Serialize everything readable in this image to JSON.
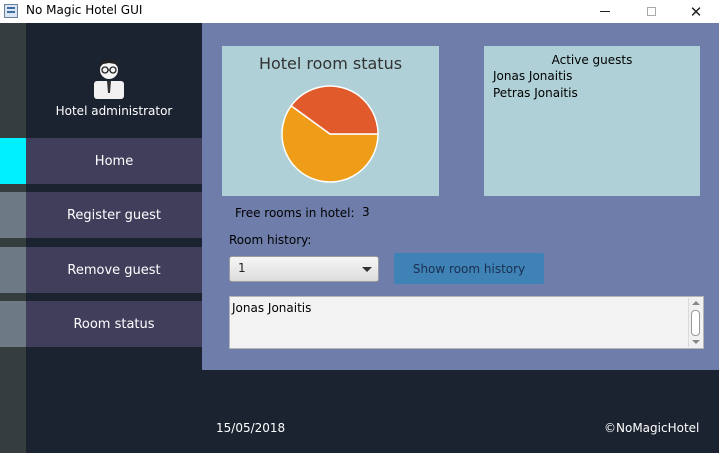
{
  "window": {
    "title": "No Magic Hotel GUI",
    "minimize_icon": "minimize-icon",
    "maximize_icon": "maximize-icon",
    "close_icon": "close-icon",
    "close_glyph": "✕"
  },
  "sidebar": {
    "avatar_icon": "hotel-administrator-avatar-icon",
    "user_label": "Hotel administrator",
    "items": [
      {
        "label": "Home",
        "active": true
      },
      {
        "label": "Register guest",
        "active": false
      },
      {
        "label": "Remove guest",
        "active": false
      },
      {
        "label": "Room status",
        "active": false
      }
    ],
    "active_color": "#00f0ff"
  },
  "room_status": {
    "title": "Hotel room status",
    "chart_data": {
      "type": "pie",
      "title": "Hotel room status",
      "slices": [
        {
          "value": 0.6,
          "color": "#ef9c18"
        },
        {
          "value": 0.4,
          "color": "#e05a2b"
        }
      ]
    }
  },
  "active_guests": {
    "title": "Active guests",
    "items": [
      "Jonas Jonaitis",
      "Petras Jonaitis"
    ]
  },
  "free_rooms": {
    "label": "Free rooms in hotel:",
    "value": "3"
  },
  "room_history": {
    "label": "Room history:",
    "selected": "1",
    "button_label": "Show room history",
    "text": "Jonas Jonaitis"
  },
  "footer": {
    "date": "15/05/2018",
    "copyright": "©NoMagicHotel"
  }
}
